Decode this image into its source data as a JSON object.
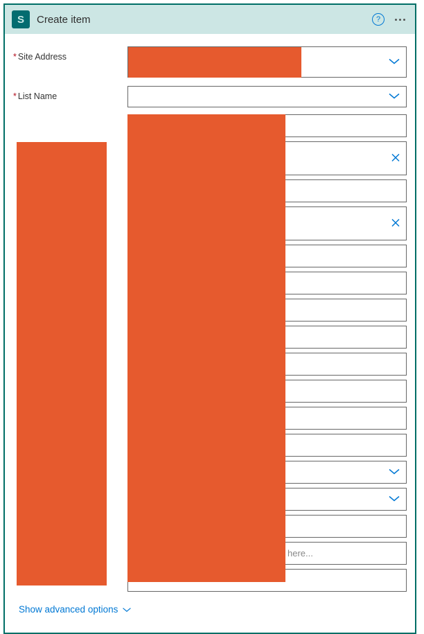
{
  "header": {
    "title": "Create item"
  },
  "labels": {
    "site_address": "Site Address",
    "list_name": "List Name"
  },
  "fields": {
    "placeholder_last": "here..."
  },
  "footer": {
    "advanced": "Show advanced options"
  }
}
